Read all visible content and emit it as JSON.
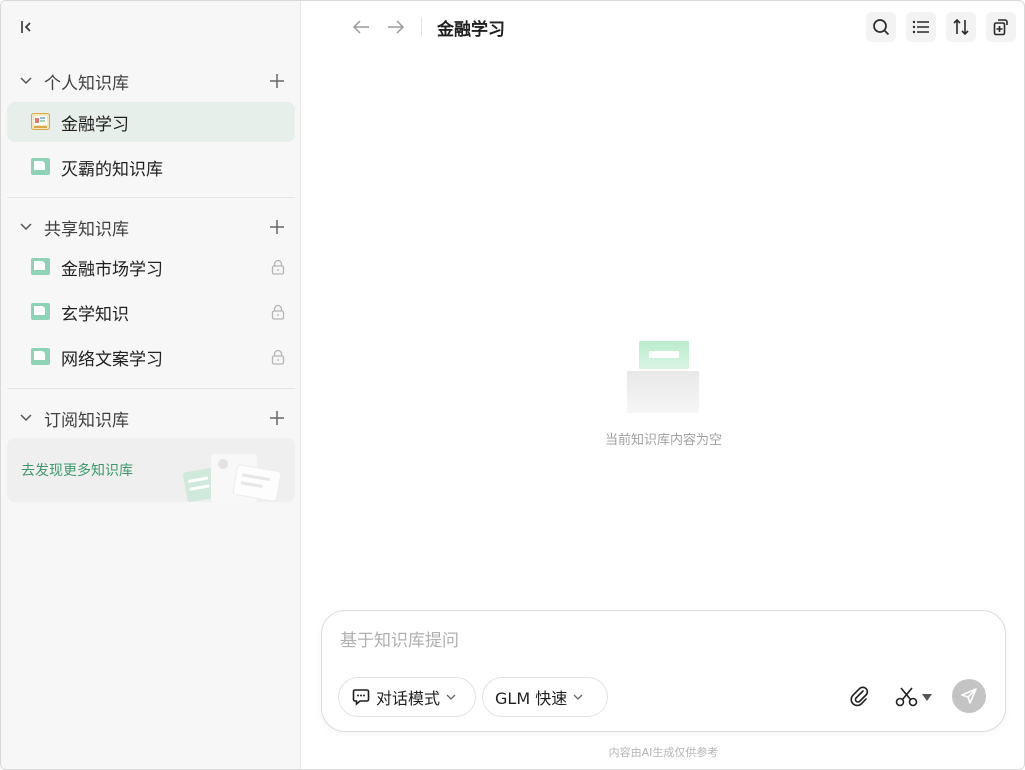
{
  "sidebar": {
    "personal": {
      "title": "个人知识库",
      "items": [
        {
          "label": "金融学习",
          "active": true
        },
        {
          "label": "灭霸的知识库",
          "active": false
        }
      ]
    },
    "shared": {
      "title": "共享知识库",
      "items": [
        {
          "label": "金融市场学习",
          "locked": true
        },
        {
          "label": "玄学知识",
          "locked": true
        },
        {
          "label": "网络文案学习",
          "locked": true
        }
      ]
    },
    "subscribed": {
      "title": "订阅知识库",
      "discover_label": "去发现更多知识库"
    }
  },
  "main": {
    "title": "金融学习",
    "empty_text": "当前知识库内容为空",
    "toolbar": [
      "search-icon",
      "list-icon",
      "sort-icon",
      "add-file-icon"
    ]
  },
  "composer": {
    "placeholder": "基于知识库提问",
    "mode_label": "对话模式",
    "model_label": "GLM 快速"
  },
  "footnote": "内容由AI生成仅供参考",
  "colors": {
    "accent": "#3e9a6d",
    "active_bg": "#e6efea",
    "send_disabled": "#c4c4c4"
  }
}
